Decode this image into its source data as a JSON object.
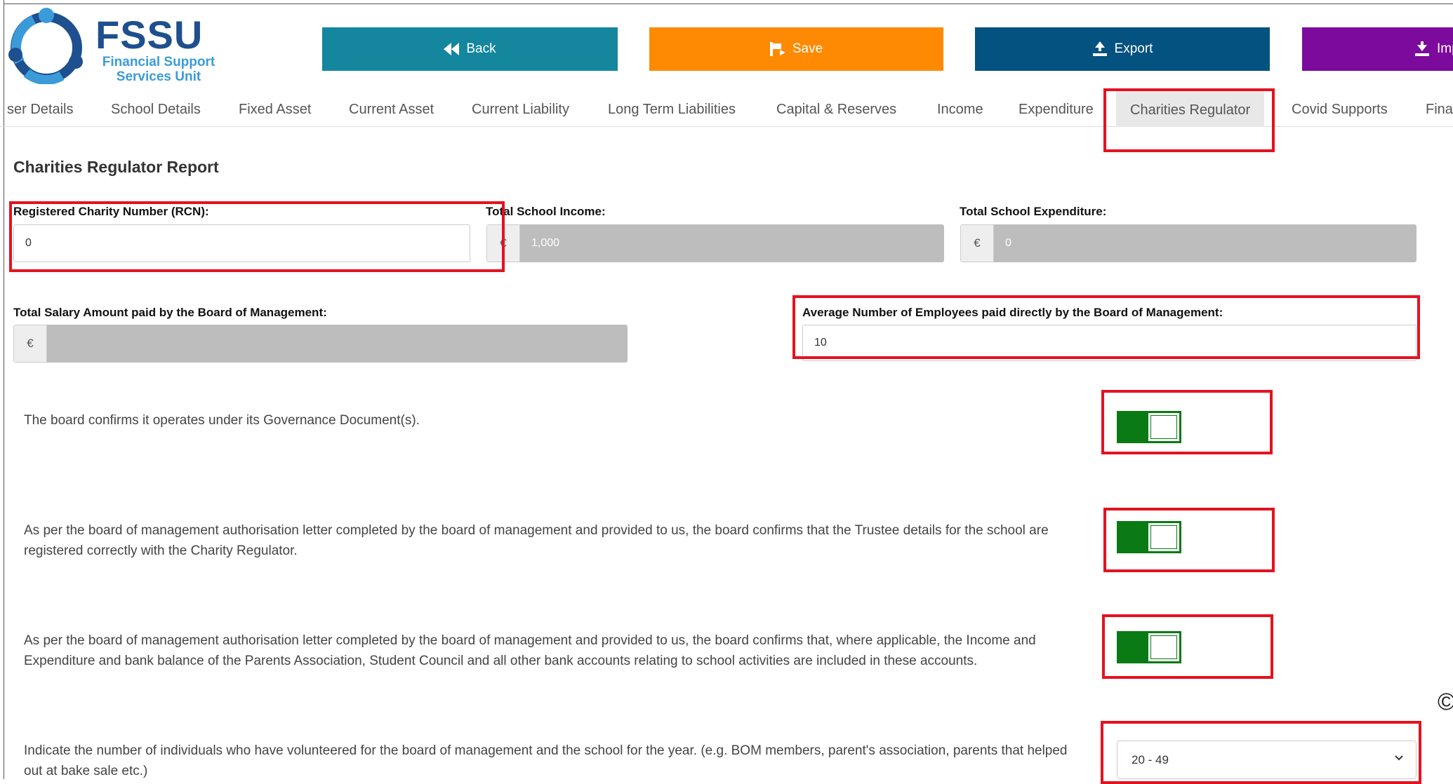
{
  "header": {
    "logo_title": "FSSU",
    "logo_subtitle_1": "Financial Support",
    "logo_subtitle_2": "Services Unit",
    "buttons": {
      "back": "Back",
      "save": "Save",
      "export": "Export",
      "import": "Imp"
    }
  },
  "tabs": [
    {
      "label": "ser Details"
    },
    {
      "label": "School Details"
    },
    {
      "label": "Fixed Asset"
    },
    {
      "label": "Current Asset"
    },
    {
      "label": "Current Liability"
    },
    {
      "label": "Long Term Liabilities"
    },
    {
      "label": "Capital & Reserves"
    },
    {
      "label": "Income"
    },
    {
      "label": "Expenditure"
    },
    {
      "label": "Charities Regulator",
      "active": true
    },
    {
      "label": "Covid Supports"
    },
    {
      "label": "Fina"
    }
  ],
  "section_title": "Charities Regulator Report",
  "fields": {
    "rcn_label": "Registered Charity Number (RCN):",
    "rcn_value": "0",
    "income_label": "Total School Income:",
    "income_currency": "€",
    "income_value": "1,000",
    "expenditure_label": "Total School Expenditure:",
    "expenditure_currency": "€",
    "expenditure_value": "0",
    "salary_label": "Total Salary Amount paid by the Board of Management:",
    "salary_currency": "€",
    "salary_value": "",
    "employees_label": "Average Number of Employees paid directly by the Board of Management:",
    "employees_value": "10"
  },
  "confirmations": [
    {
      "text": "The board confirms it operates under its Governance Document(s).",
      "checked": true
    },
    {
      "text": "As per the board of management authorisation letter completed by the board of management and provided to us, the board confirms that the Trustee details for the school are registered correctly with the Charity Regulator.",
      "checked": true
    },
    {
      "text": "As per the board of management authorisation letter completed by the board of management and provided to us, the board confirms that, where applicable, the Income and Expenditure and bank balance of the Parents Association, Student Council and all other bank accounts relating to school activities are included in these accounts.",
      "checked": true
    }
  ],
  "volunteers": {
    "text": "Indicate the number of individuals who have volunteered for the board of management and the school for the year. (e.g. BOM members, parent's association, parents that helped out at bake sale etc.)",
    "selected": "20 - 49"
  },
  "copyright_symbol": "©",
  "colors": {
    "back": "#14869e",
    "save": "#fd8a02",
    "export": "#03527f",
    "import": "#7c0a9c",
    "toggle_on": "#0a7a14",
    "highlight": "#e4121f"
  }
}
